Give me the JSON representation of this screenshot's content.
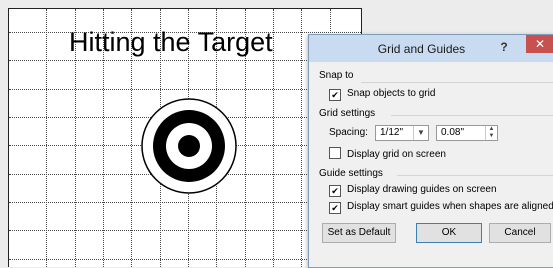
{
  "slide": {
    "title": "Hitting the Target"
  },
  "dialog": {
    "title": "Grid and Guides",
    "help_glyph": "?",
    "close_glyph": "✕",
    "snap_section": "Snap to",
    "snap_objects_label": "Snap objects to grid",
    "snap_objects_checked": true,
    "grid_section": "Grid settings",
    "spacing_label": "Spacing:",
    "spacing_select_value": "1/12\"",
    "spacing_value": "0.08\"",
    "display_grid_label": "Display grid on screen",
    "display_grid_checked": false,
    "guide_section": "Guide settings",
    "drawing_guides_label": "Display drawing guides on screen",
    "drawing_guides_checked": true,
    "smart_guides_label": "Display smart guides when shapes are aligned",
    "smart_guides_checked": true,
    "set_default_label": "Set as Default",
    "ok_label": "OK",
    "cancel_label": "Cancel"
  },
  "colors": {
    "titlebar": "#c8dbf1",
    "close": "#c75050",
    "target": "#000000"
  },
  "icons": {
    "check": "✔",
    "dropdown": "chevron-down-icon",
    "spin": "spin-arrows-icon"
  }
}
